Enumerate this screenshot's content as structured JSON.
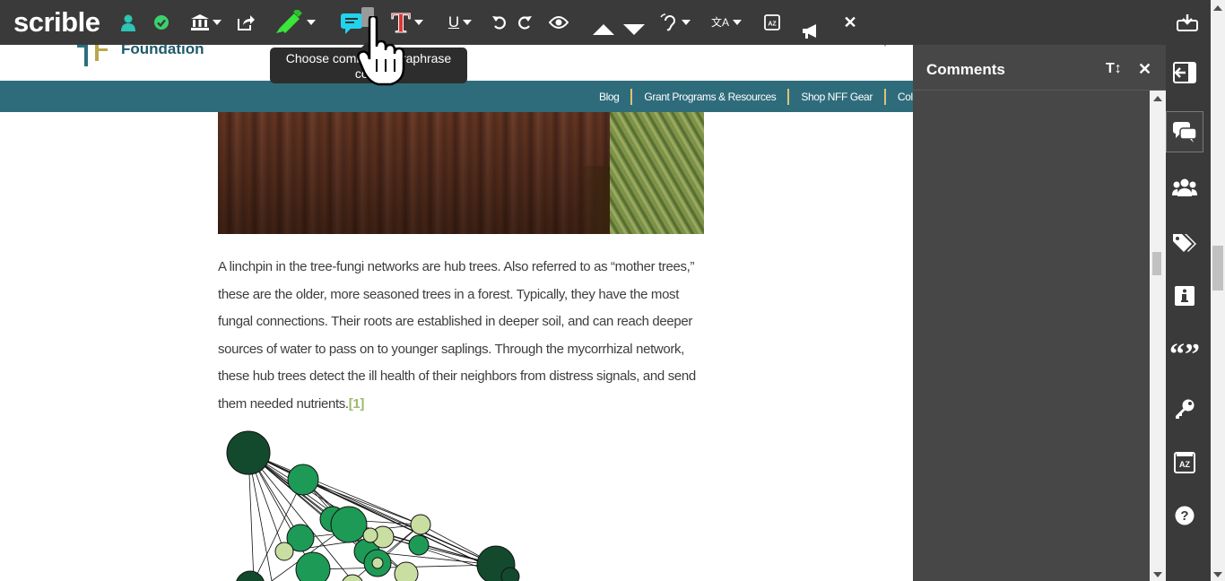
{
  "toolbar": {
    "logo": "scrible",
    "tooltip_line1": "Choose comment/paraphrase",
    "tooltip_line2": "color",
    "icons": [
      "user-icon",
      "check-circle-icon",
      "library-icon",
      "share-icon",
      "highlighter-icon",
      "comment-icon",
      "text-color-icon",
      "underline-icon",
      "undo-icon",
      "redo-icon",
      "eye-icon",
      "previous-annotation-icon",
      "next-annotation-icon",
      "listen-icon",
      "translate-icon",
      "dictionary-icon",
      "announce-icon",
      "close-icon",
      "save-download-icon"
    ],
    "highlighter_color": "#39e639",
    "comment_color": "#22d3ee",
    "text_color": "#e03131"
  },
  "site": {
    "logo_text": "Foundation",
    "nav_links": [
      "Blog",
      "Grant Programs & Resources",
      "Shop NFF Gear",
      "Collabora"
    ],
    "navbar_color": "#2f6c7b",
    "paragraph": "A linchpin in the tree-fungi networks are hub trees. Also referred to as “mother trees,” these are the older, more seasoned trees in a forest. Typically, they have the most fungal connections. Their roots are established in deeper soil, and can reach deeper sources of water to pass on to younger saplings. Through the mycorrhizal network, these hub trees detect the ill health of their neighbors from distress signals, and send them needed nutrients.",
    "citation": "[1]"
  },
  "comments": {
    "title": "Comments",
    "sort_label": "T↕"
  },
  "rail": {
    "items": [
      "collapse-panel-icon",
      "comments-icon",
      "group-icon",
      "tags-icon",
      "info-icon",
      "quote-icon",
      "key-icon",
      "dictionary-icon",
      "help-icon"
    ]
  }
}
